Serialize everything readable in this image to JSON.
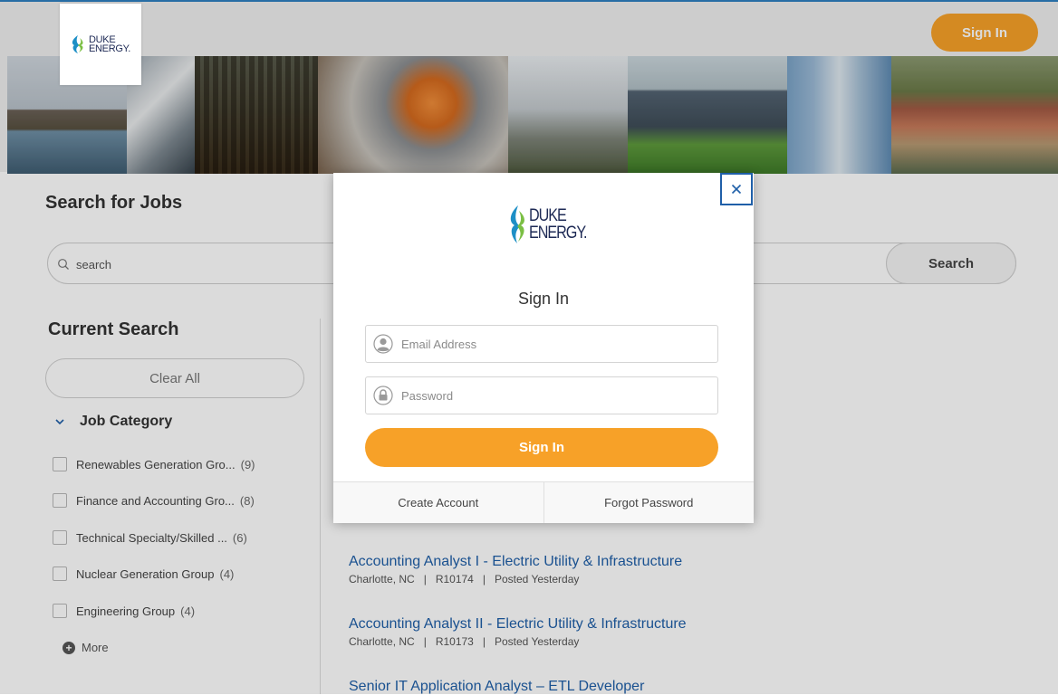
{
  "header": {
    "logo_line1": "DUKE",
    "logo_line2": "ENERGY.",
    "sign_in_label": "Sign In"
  },
  "search": {
    "title": "Search for Jobs",
    "placeholder": "search",
    "button_label": "Search"
  },
  "sidebar": {
    "current_search_title": "Current Search",
    "clear_all_label": "Clear All",
    "category_title": "Job Category",
    "facets": [
      {
        "label": "Renewables Generation Gro...",
        "count": "(9)"
      },
      {
        "label": "Finance and Accounting Gro...",
        "count": "(8)"
      },
      {
        "label": "Technical Specialty/Skilled ...",
        "count": "(6)"
      },
      {
        "label": "Nuclear Generation Group",
        "count": "(4)"
      },
      {
        "label": "Engineering Group",
        "count": "(4)"
      }
    ],
    "more_label": "More"
  },
  "jobs": [
    {
      "title": "Accounting Analyst I - Electric Utility & Infrastructure",
      "meta": "Charlotte, NC   |   R10174   |   Posted Yesterday"
    },
    {
      "title": "Accounting Analyst II - Electric Utility & Infrastructure",
      "meta": "Charlotte, NC   |   R10173   |   Posted Yesterday"
    },
    {
      "title": "Senior IT Application Analyst – ETL Developer",
      "meta": ""
    }
  ],
  "modal": {
    "logo_line1": "DUKE",
    "logo_line2": "ENERGY.",
    "title": "Sign In",
    "email_placeholder": "Email Address",
    "password_placeholder": "Password",
    "sign_in_label": "Sign In",
    "create_account_label": "Create Account",
    "forgot_password_label": "Forgot Password"
  },
  "colors": {
    "accent_orange": "#f7a128",
    "link_blue": "#1f5fa8"
  }
}
